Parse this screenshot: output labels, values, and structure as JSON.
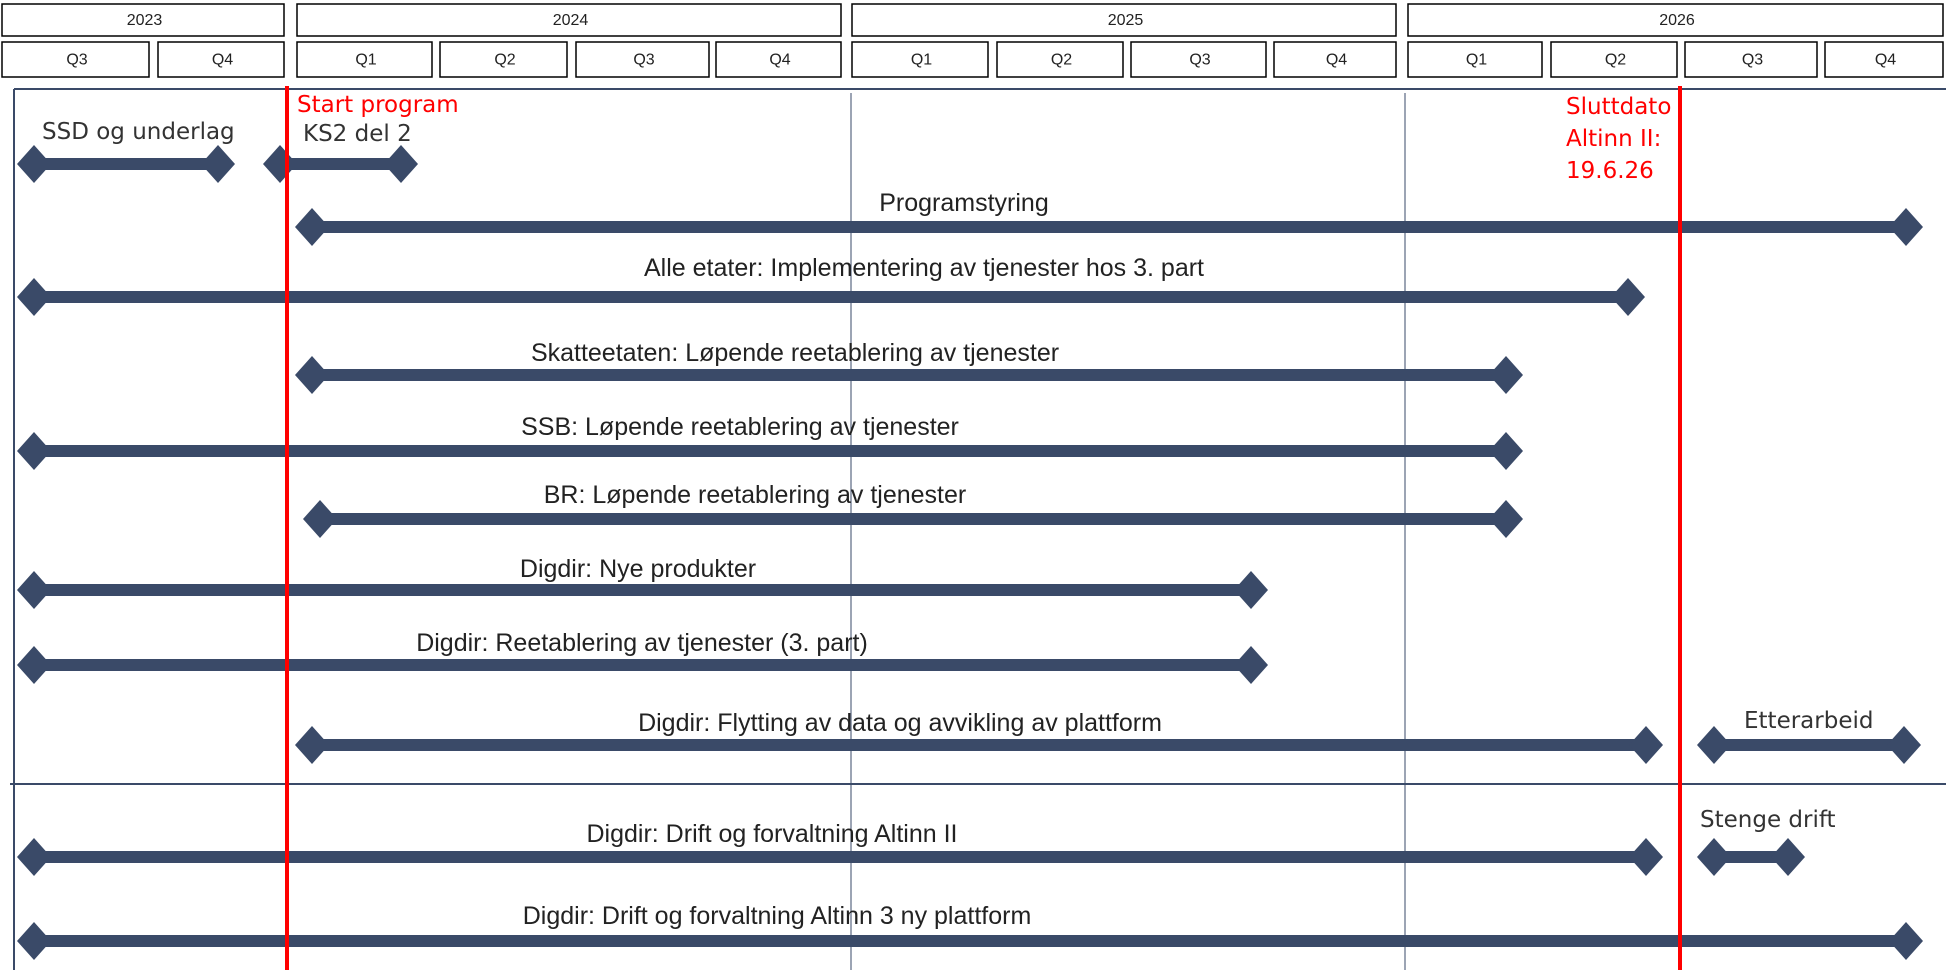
{
  "timeline": {
    "years": [
      "2023",
      "2024",
      "2025",
      "2026"
    ],
    "quarters": [
      "Q3",
      "Q4",
      "Q1",
      "Q2",
      "Q3",
      "Q4",
      "Q1",
      "Q2",
      "Q3",
      "Q4",
      "Q1",
      "Q2",
      "Q3",
      "Q4"
    ]
  },
  "milestones": [
    {
      "lines": [
        "Start program"
      ],
      "color": "#ff0000"
    },
    {
      "lines": [
        "Sluttdato",
        "Altinn II:",
        "19.6.26"
      ],
      "color": "#ff0000"
    }
  ],
  "rows": [
    {
      "label": "",
      "bars": [
        {
          "start": "2023 Q3",
          "end": "2023 Q4",
          "label": "SSD og underlag"
        },
        {
          "start": "2023 Q4",
          "end": "2024 Q1",
          "label": "KS2 del 2"
        }
      ]
    },
    {
      "label": "Programstyring",
      "bars": [
        {
          "start": "2024 Q1",
          "end": "2026 Q4"
        }
      ]
    },
    {
      "label": "Alle etater: Implementering av tjenester hos 3. part",
      "bars": [
        {
          "start": "2023 Q3",
          "end": "2026 Q2"
        }
      ]
    },
    {
      "label": "Skatteetaten: Løpende reetablering av tjenester",
      "bars": [
        {
          "start": "2024 Q1",
          "end": "2026 Q1"
        }
      ]
    },
    {
      "label": "SSB: Løpende reetablering av tjenester",
      "bars": [
        {
          "start": "2023 Q3",
          "end": "2026 Q1"
        }
      ]
    },
    {
      "label": "BR: Løpende reetablering av tjenester",
      "bars": [
        {
          "start": "2024 Q1",
          "end": "2026 Q1"
        }
      ]
    },
    {
      "label": "Digdir: Nye produkter",
      "bars": [
        {
          "start": "2023 Q3",
          "end": "2025 Q3"
        }
      ]
    },
    {
      "label": "Digdir: Reetablering av tjenester (3. part)",
      "bars": [
        {
          "start": "2023 Q3",
          "end": "2025 Q3"
        }
      ]
    },
    {
      "label": "Digdir: Flytting av data og avvikling av plattform",
      "bars": [
        {
          "start": "2024 Q1",
          "end": "2026 Q2"
        },
        {
          "start": "2026 Q3",
          "end": "2026 Q4",
          "label": "Etterarbeid"
        }
      ]
    },
    {
      "label": "Digdir: Drift og forvaltning Altinn II",
      "bars": [
        {
          "start": "2023 Q3",
          "end": "2026 Q2"
        },
        {
          "start": "2026 Q3",
          "end": "2026 Q3",
          "label": "Stenge drift"
        }
      ]
    },
    {
      "label": "Digdir: Drift og forvaltning Altinn 3 ny plattform",
      "bars": [
        {
          "start": "2023 Q3",
          "end": "2026 Q4"
        }
      ]
    }
  ]
}
